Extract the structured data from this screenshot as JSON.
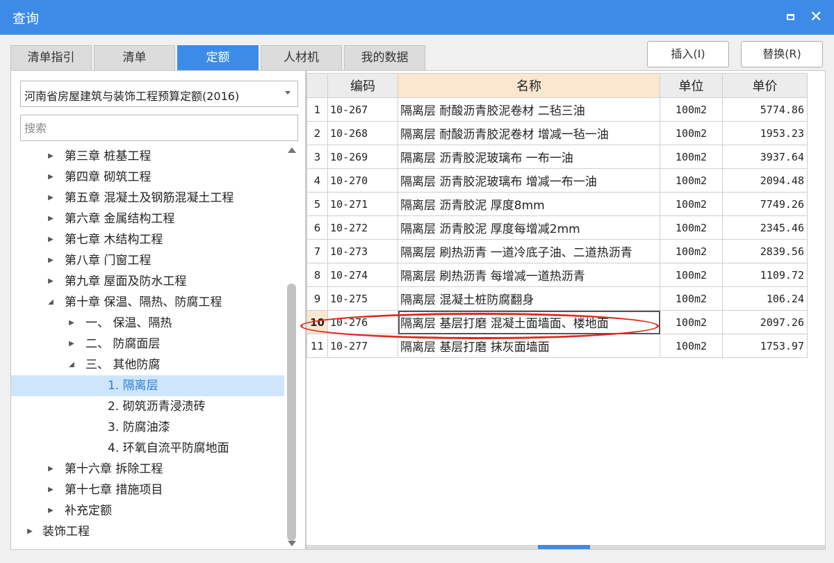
{
  "window": {
    "title": "查询"
  },
  "tabs": [
    {
      "label": "清单指引",
      "active": false
    },
    {
      "label": "清单",
      "active": false
    },
    {
      "label": "定额",
      "active": true
    },
    {
      "label": "人材机",
      "active": false
    },
    {
      "label": "我的数据",
      "active": false
    }
  ],
  "actions": {
    "insert": "插入(I)",
    "replace": "替换(R)"
  },
  "sidebar": {
    "library": "河南省房屋建筑与装饰工程预算定额(2016)",
    "search_placeholder": "搜索",
    "tree": [
      {
        "label": "第三章 桩基工程",
        "level": 1,
        "toggle": "collapsed"
      },
      {
        "label": "第四章 砌筑工程",
        "level": 1,
        "toggle": "collapsed"
      },
      {
        "label": "第五章 混凝土及钢筋混凝土工程",
        "level": 1,
        "toggle": "collapsed"
      },
      {
        "label": "第六章 金属结构工程",
        "level": 1,
        "toggle": "collapsed"
      },
      {
        "label": "第七章 木结构工程",
        "level": 1,
        "toggle": "collapsed"
      },
      {
        "label": "第八章 门窗工程",
        "level": 1,
        "toggle": "collapsed"
      },
      {
        "label": "第九章 屋面及防水工程",
        "level": 1,
        "toggle": "collapsed"
      },
      {
        "label": "第十章 保温、隔热、防腐工程",
        "level": 1,
        "toggle": "expanded"
      },
      {
        "label": "一、 保温、隔热",
        "level": 2,
        "toggle": "collapsed"
      },
      {
        "label": "二、 防腐面层",
        "level": 2,
        "toggle": "collapsed"
      },
      {
        "label": "三、 其他防腐",
        "level": 2,
        "toggle": "expanded"
      },
      {
        "label": "1. 隔离层",
        "level": 3,
        "toggle": "none",
        "selected": true
      },
      {
        "label": "2. 砌筑沥青浸渍砖",
        "level": 3,
        "toggle": "none"
      },
      {
        "label": "3. 防腐油漆",
        "level": 3,
        "toggle": "none"
      },
      {
        "label": "4. 环氧自流平防腐地面",
        "level": 3,
        "toggle": "none"
      },
      {
        "label": "第十六章 拆除工程",
        "level": 1,
        "toggle": "collapsed"
      },
      {
        "label": "第十七章 措施项目",
        "level": 1,
        "toggle": "collapsed"
      },
      {
        "label": "补充定额",
        "level": 1,
        "toggle": "collapsed"
      },
      {
        "label": "装饰工程",
        "level": 0,
        "toggle": "collapsed"
      }
    ]
  },
  "table": {
    "headers": {
      "code": "编码",
      "name": "名称",
      "unit": "单位",
      "price": "单价"
    },
    "current_row": 10,
    "rows": [
      {
        "idx": "1",
        "code": "10-267",
        "name": "隔离层 耐酸沥青胶泥卷材 二毡三油",
        "unit": "100m2",
        "price": "5774.86"
      },
      {
        "idx": "2",
        "code": "10-268",
        "name": "隔离层 耐酸沥青胶泥卷材 增减一毡一油",
        "unit": "100m2",
        "price": "1953.23"
      },
      {
        "idx": "3",
        "code": "10-269",
        "name": "隔离层 沥青胶泥玻璃布 一布一油",
        "unit": "100m2",
        "price": "3937.64"
      },
      {
        "idx": "4",
        "code": "10-270",
        "name": "隔离层 沥青胶泥玻璃布 增减一布一油",
        "unit": "100m2",
        "price": "2094.48"
      },
      {
        "idx": "5",
        "code": "10-271",
        "name": "隔离层 沥青胶泥 厚度8mm",
        "unit": "100m2",
        "price": "7749.26"
      },
      {
        "idx": "6",
        "code": "10-272",
        "name": "隔离层 沥青胶泥 厚度每增减2mm",
        "unit": "100m2",
        "price": "2345.46"
      },
      {
        "idx": "7",
        "code": "10-273",
        "name": "隔离层 刷热沥青 一道冷底子油、二道热沥青",
        "unit": "100m2",
        "price": "2839.56"
      },
      {
        "idx": "8",
        "code": "10-274",
        "name": "隔离层 刷热沥青 每增减一道热沥青",
        "unit": "100m2",
        "price": "1109.72"
      },
      {
        "idx": "9",
        "code": "10-275",
        "name": "隔离层 混凝土桩防腐翻身",
        "unit": "100m2",
        "price": "106.24"
      },
      {
        "idx": "10",
        "code": "10-276",
        "name": "隔离层 基层打磨 混凝土面墙面、楼地面",
        "unit": "100m2",
        "price": "2097.26"
      },
      {
        "idx": "11",
        "code": "10-277",
        "name": "隔离层 基层打磨 抹灰面墙面",
        "unit": "100m2",
        "price": "1753.97"
      }
    ]
  },
  "colors": {
    "accent": "#3c8ce7",
    "highlight_ellipse": "#e0281e",
    "selected_header": "#fbe7cf"
  }
}
